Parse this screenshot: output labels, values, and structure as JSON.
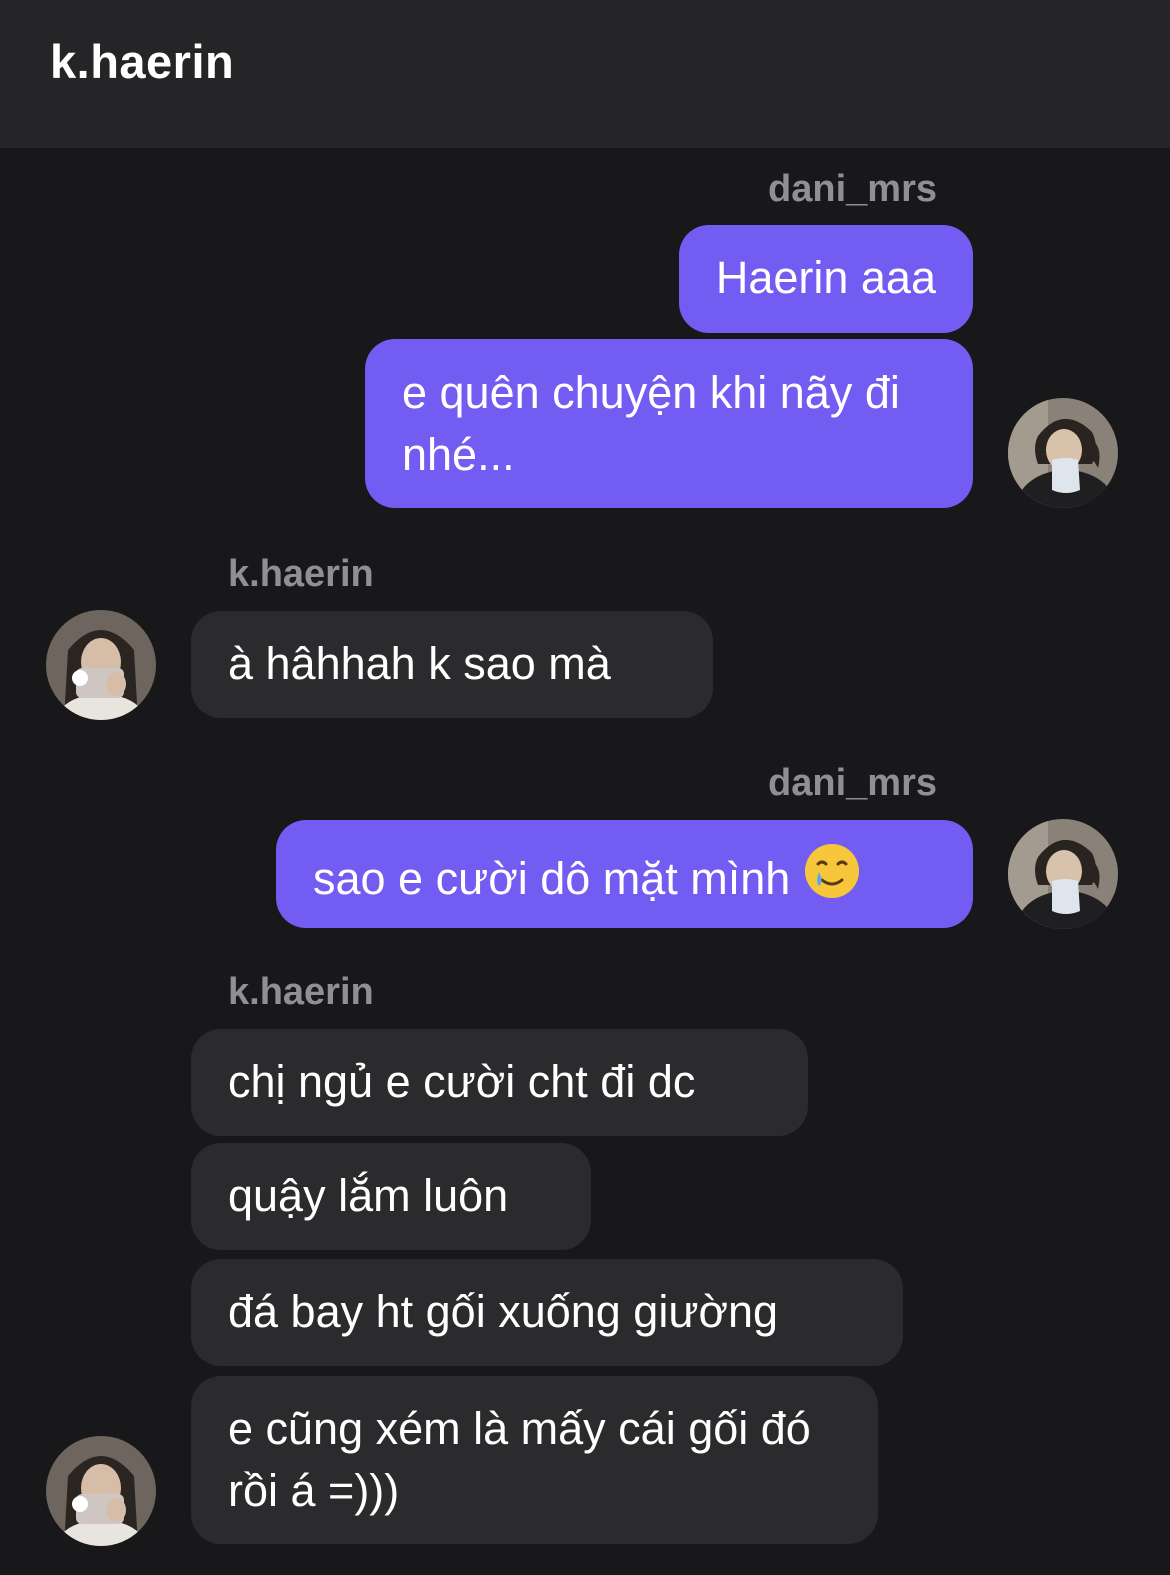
{
  "header": {
    "title": "k.haerin"
  },
  "conversation": {
    "group1": {
      "sender": "dani_mrs",
      "messages": [
        "Haerin aaa",
        "e quên chuyện khi nãy đi nhé..."
      ]
    },
    "group2": {
      "sender": "k.haerin",
      "messages": [
        "à hâhhah k sao mà"
      ]
    },
    "group3": {
      "sender": "dani_mrs",
      "messages": [
        "sao e cười dô mặt mình"
      ],
      "emoji": "face-holding-back-tears-emoji"
    },
    "group4": {
      "sender": "k.haerin",
      "messages": [
        "chị ngủ e cười cht đi dc",
        "quậy lắm luôn",
        "đá bay ht gối xuống giường",
        "e cũng xém là mấy cái gối đó rồi á =)))"
      ]
    }
  },
  "colors": {
    "background": "#18181b",
    "header": "#252527",
    "outgoing_bubble": "#735cf2",
    "incoming_bubble": "#2b2b2e",
    "sender_label": "#8f8f95"
  }
}
